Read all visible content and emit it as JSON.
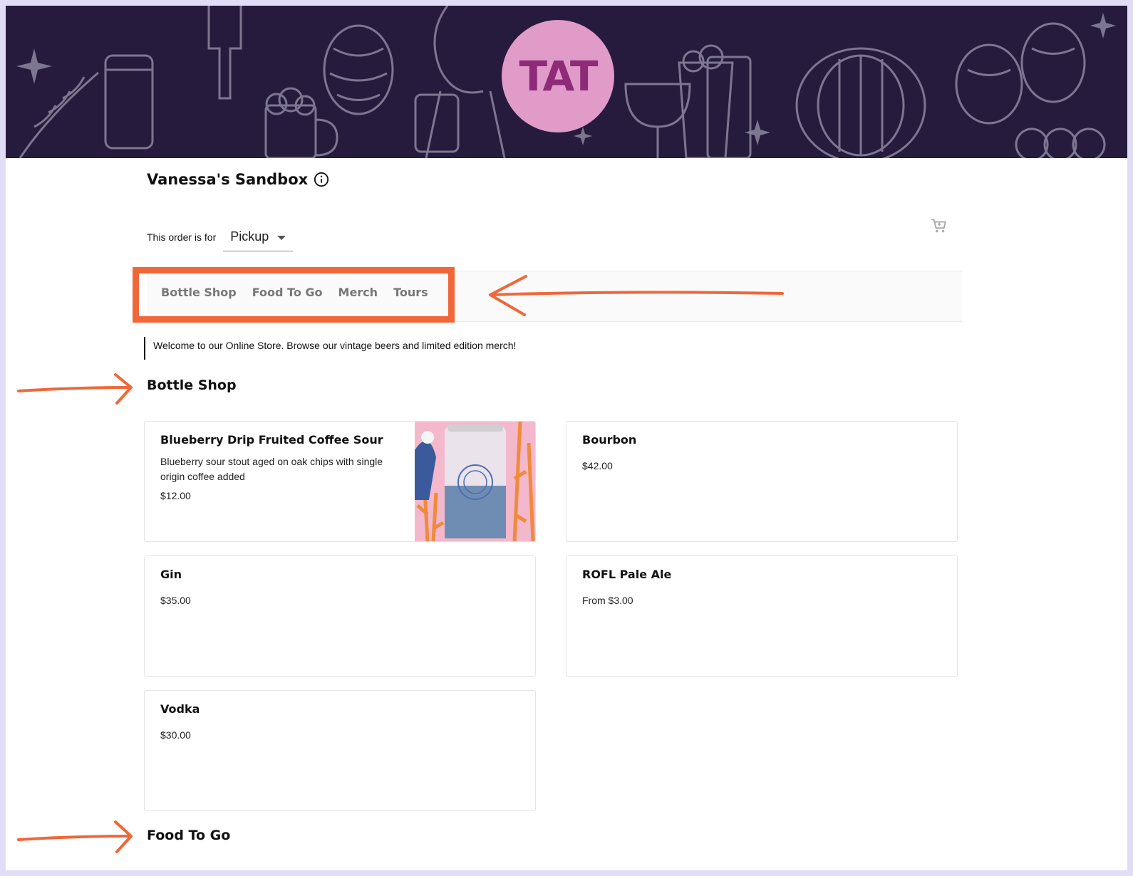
{
  "banner": {
    "logo_text": "TAT",
    "background": "#271b3d",
    "logo_color": "#e09bc9"
  },
  "store": {
    "name": "Vanessa's Sandbox"
  },
  "order": {
    "label": "This order is for",
    "selected": "Pickup"
  },
  "nav": {
    "tabs": [
      "Bottle Shop",
      "Food To Go",
      "Merch",
      "Tours"
    ]
  },
  "welcome": "Welcome to our Online Store. Browse our vintage beers and limited edition merch!",
  "sections": {
    "bottle_shop": {
      "heading": "Bottle Shop",
      "products": [
        {
          "name": "Blueberry Drip Fruited Coffee Sour",
          "description": "Blueberry sour stout aged on oak chips with single origin coffee added",
          "price": "$12.00"
        },
        {
          "name": "Bourbon",
          "price": "$42.00"
        },
        {
          "name": "Gin",
          "price": "$35.00"
        },
        {
          "name": "ROFL Pale Ale",
          "price": "From $3.00"
        },
        {
          "name": "Vodka",
          "price": "$30.00"
        }
      ]
    },
    "food_to_go": {
      "heading": "Food To Go"
    }
  },
  "annotations": {
    "color": "#f0673a"
  }
}
